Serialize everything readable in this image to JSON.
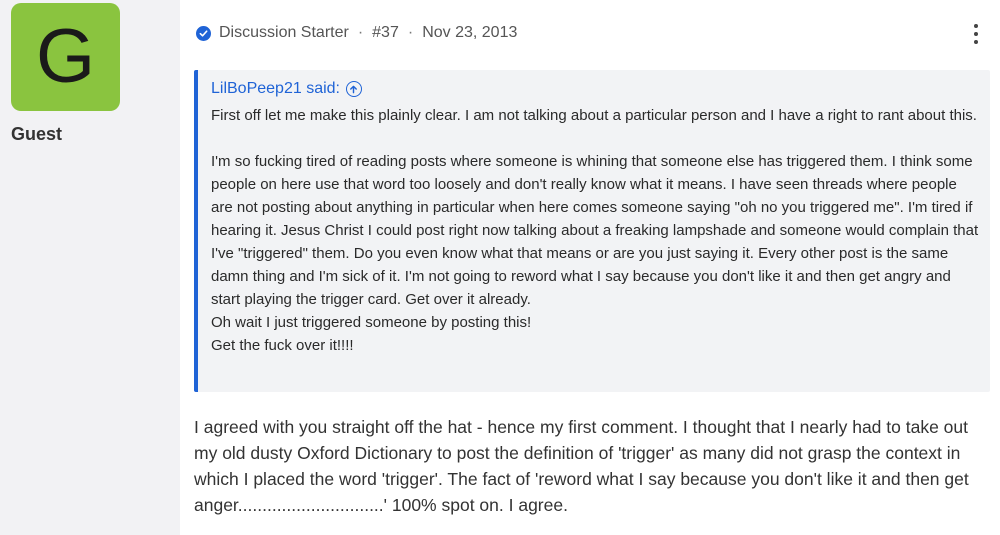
{
  "author": {
    "avatar_letter": "G",
    "avatar_color": "#8ac43f",
    "username": "Guest"
  },
  "post_meta": {
    "badge_icon": "check-circle-icon",
    "role": "Discussion Starter",
    "post_number": "#37",
    "date": "Nov 23, 2013",
    "menu_icon": "more-vertical-icon"
  },
  "quote": {
    "author_label": "LilBoPeep21 said:",
    "jump_icon": "arrow-up-circle-icon",
    "text": "First off let me make this plainly clear. I am not talking about a particular person and I have a right to rant about this.\n\nI'm so fucking tired of reading posts where someone is whining that someone else has triggered them. I think some people on here use that word too loosely and don't really know what it means. I have seen threads where people are not posting about anything in particular when here comes someone saying \"oh no you triggered me\". I'm tired if hearing it. Jesus Christ I could post right now talking about a freaking lampshade and someone would complain that I've \"triggered\" them. Do you even know what that means or are you just saying it. Every other post is the same damn thing and I'm sick of it. I'm not going to reword what I say because you don't like it and then get angry and start playing the trigger card. Get over it already.\nOh wait I just triggered someone by posting this!\nGet the fuck over it!!!!"
  },
  "reply": {
    "text": "I agreed with you straight off the hat - hence my first comment. I thought that I nearly had to take out my old dusty Oxford Dictionary to post the definition of 'trigger' as many did not grasp the context in which I placed the word 'trigger'. The fact of 'reword what I say because you don't like it and then get anger..............................' 100% spot on. I agree."
  },
  "colors": {
    "accent": "#1f63d6",
    "quote_background": "#f2f3f5"
  }
}
